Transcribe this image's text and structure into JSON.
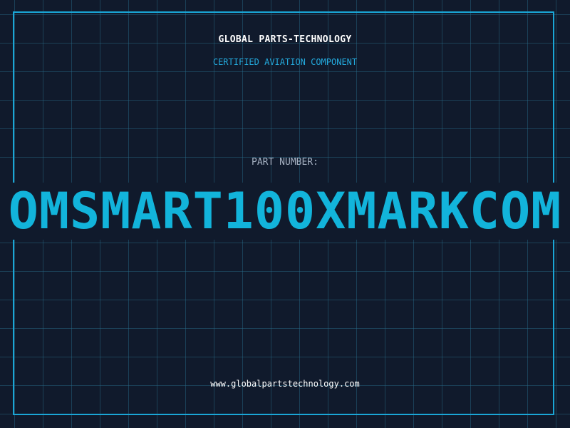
{
  "header": {
    "company": "GLOBAL PARTS-TECHNOLOGY",
    "subtitle": "CERTIFIED AVIATION COMPONENT"
  },
  "part": {
    "label": "PART NUMBER:",
    "number": "OMSMART100XMARKCOM"
  },
  "footer": {
    "url": "www.globalpartstechnology.com"
  },
  "colors": {
    "background": "#101a2c",
    "grid": "#286e8c",
    "frame": "#1aa6d6",
    "accent": "#12b4db",
    "label": "#a6b1c2",
    "text": "#ffffff"
  }
}
